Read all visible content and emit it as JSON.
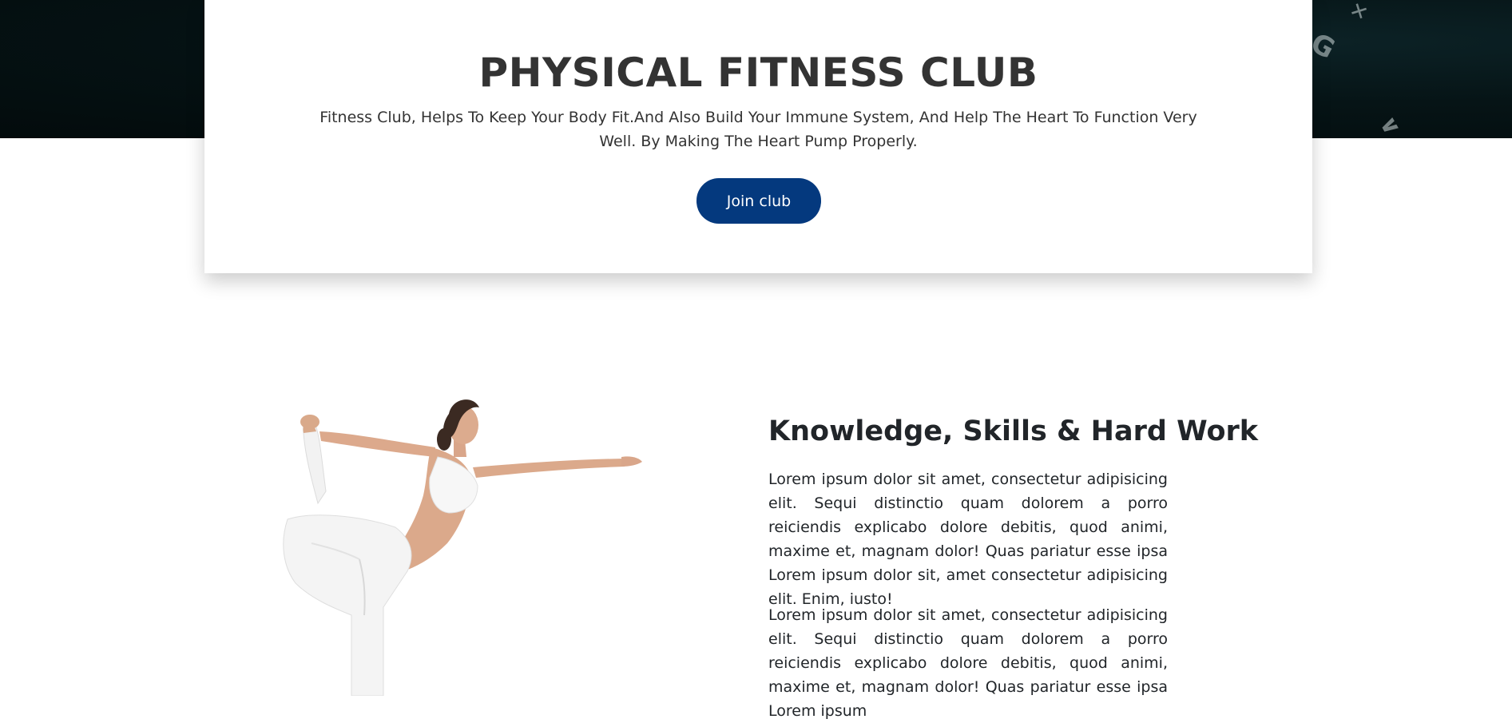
{
  "hero": {
    "title": "PHYSICAL FITNESS CLUB",
    "text": "Fitness Club, Helps To Keep Your Body Fit.And Also Build Your Immune System, And Help The Heart To Function Very Well. By Making The Heart Pump Properly.",
    "button_label": "Join club",
    "button_color": "#04397e",
    "background_color": "#061416"
  },
  "about": {
    "title": "Knowledge, Skills & Hard Work",
    "paragraphs": [
      "Lorem ipsum dolor sit amet, consectetur adipisicing elit. Sequi distinctio quam dolorem a porro reiciendis explicabo dolore debitis, quod animi, maxime et, magnam dolor! Quas pariatur esse ipsa Lorem ipsum dolor sit, amet consectetur adipisicing elit. Enim, iusto!",
      "Lorem ipsum dolor sit amet, consectetur adipisicing elit. Sequi distinctio quam dolorem a porro reiciendis explicabo dolore debitis, quod animi, maxime et, magnam dolor! Quas pariatur esse ipsa Lorem ipsum"
    ],
    "image_icon": "yoga-woman-image"
  }
}
